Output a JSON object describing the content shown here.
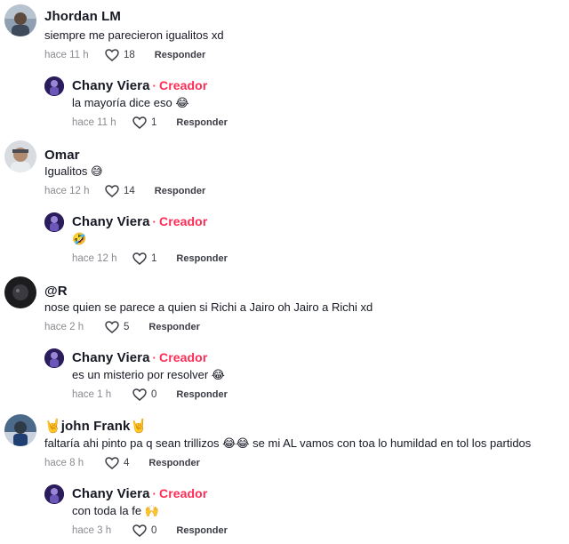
{
  "comments": [
    {
      "author": "Jhordan LM",
      "text": "siempre me parecieron igualitos xd",
      "time": "hace 11 h",
      "likes": "18",
      "reply_label": "Responder",
      "reply": {
        "author": "Chany Viera",
        "badge": "Creador",
        "text": "la mayoría dice eso 😂",
        "time": "hace 11 h",
        "likes": "1",
        "reply_label": "Responder"
      }
    },
    {
      "author": "Omar",
      "text": "Igualitos 😅",
      "time": "hace 12 h",
      "likes": "14",
      "reply_label": "Responder",
      "reply": {
        "author": "Chany Viera",
        "badge": "Creador",
        "text": "🤣",
        "time": "hace 12 h",
        "likes": "1",
        "reply_label": "Responder"
      }
    },
    {
      "author": "@R",
      "text": "nose quien se parece a quien si Richi a Jairo oh Jairo a Richi xd",
      "time": "hace 2 h",
      "likes": "5",
      "reply_label": "Responder",
      "reply": {
        "author": "Chany Viera",
        "badge": "Creador",
        "text": "es un misterio por resolver 😂",
        "time": "hace 1 h",
        "likes": "0",
        "reply_label": "Responder"
      }
    },
    {
      "author": "🤘john Frank🤘",
      "text": "faltaría ahi pinto pa q sean trillizos 😂😂 se mi AL vamos con toa lo humildad en tol los partidos",
      "time": "hace 8 h",
      "likes": "4",
      "reply_label": "Responder",
      "reply": {
        "author": "Chany Viera",
        "badge": "Creador",
        "text": "con toda la fe 🙌",
        "time": "hace 3 h",
        "likes": "0",
        "reply_label": "Responder"
      }
    }
  ],
  "icons": {
    "like": "heart-outline-icon"
  },
  "colors": {
    "creator": "#fe2c55",
    "meta": "#8a8b91"
  }
}
